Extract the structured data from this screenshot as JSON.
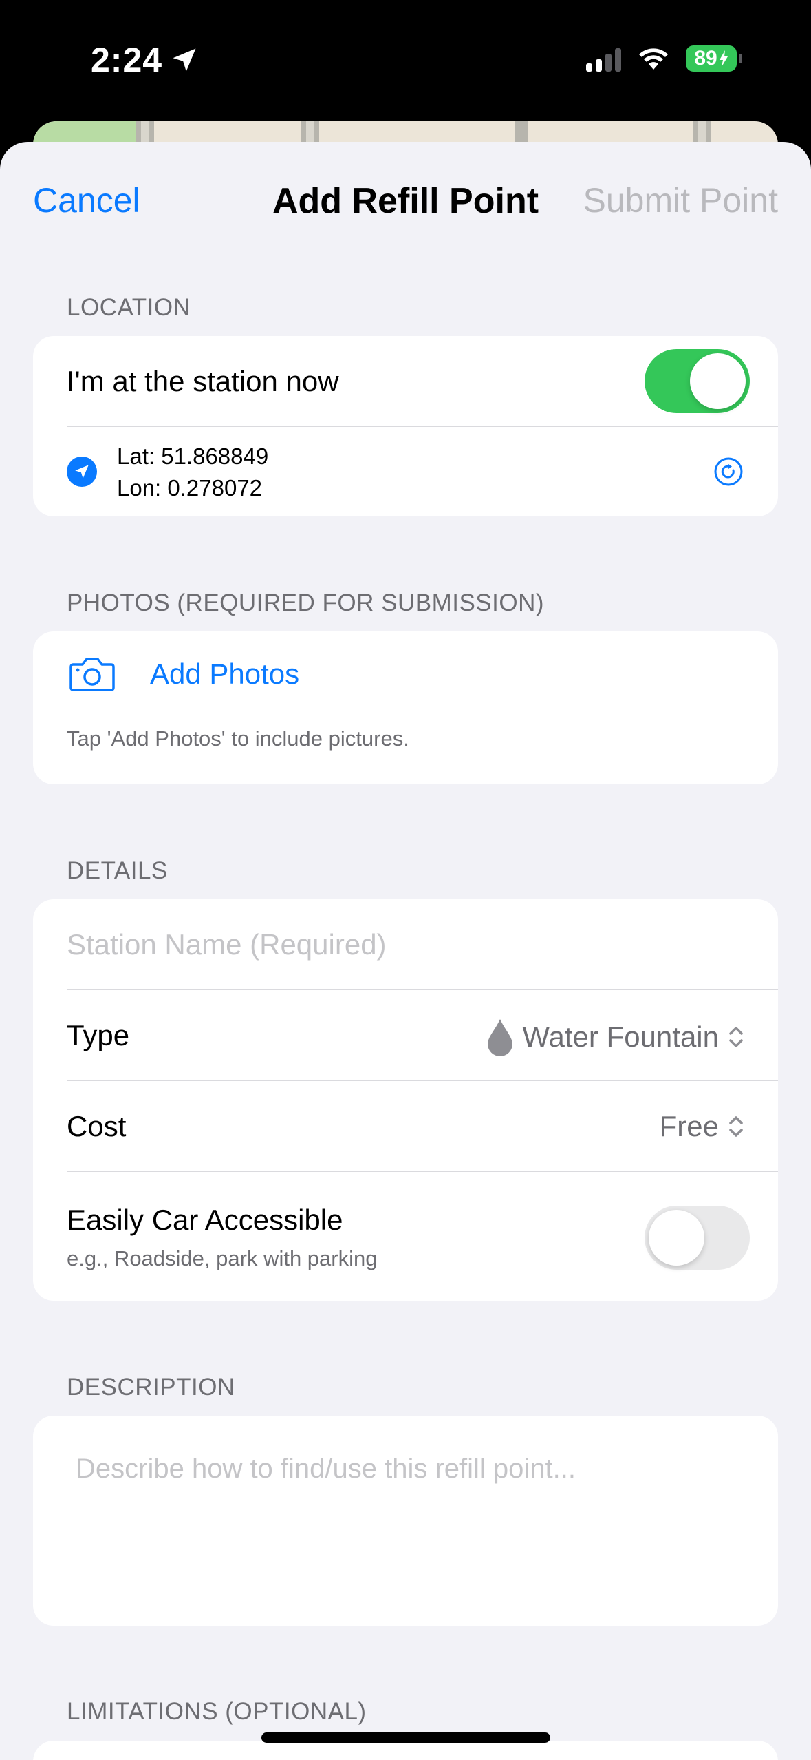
{
  "status_bar": {
    "time": "2:24",
    "battery_level": "89",
    "battery_color": "#34c759"
  },
  "nav": {
    "cancel_label": "Cancel",
    "title": "Add Refill Point",
    "submit_label": "Submit Point",
    "accent_color": "#0a7aff"
  },
  "location": {
    "header": "LOCATION",
    "at_station_label": "I'm at the station now",
    "at_station_on": true,
    "lat": "Lat: 51.868849",
    "lon": "Lon: 0.278072"
  },
  "photos": {
    "header": "PHOTOS (REQUIRED FOR SUBMISSION)",
    "add_label": "Add Photos",
    "hint": "Tap 'Add Photos' to include pictures."
  },
  "details": {
    "header": "DETAILS",
    "station_name_placeholder": "Station Name (Required)",
    "type_label": "Type",
    "type_value": "Water Fountain",
    "type_icon": "water-drop-icon",
    "cost_label": "Cost",
    "cost_value": "Free",
    "car_label": "Easily Car Accessible",
    "car_subtext": "e.g., Roadside, park with parking",
    "car_on": false
  },
  "description": {
    "header": "DESCRIPTION",
    "placeholder": "Describe how to find/use this refill point..."
  },
  "limitations": {
    "header": "LIMITATIONS (OPTIONAL)"
  }
}
